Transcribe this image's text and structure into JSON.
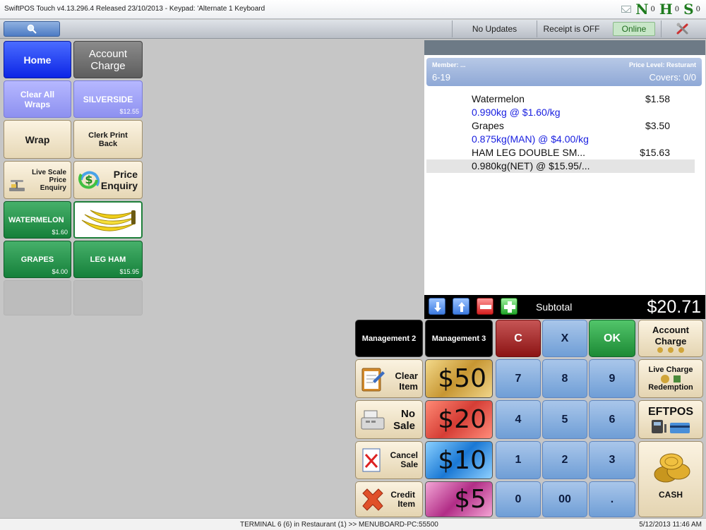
{
  "titlebar": {
    "title": "SwiftPOS Touch v4.13.296.4 Released 23/10/2013 -  Keypad: 'Alternate 1 Keyboard",
    "n_label": "N",
    "n_count": "0",
    "h_label": "H",
    "h_count": "0",
    "s_label": "S",
    "s_count": "0"
  },
  "toolbar": {
    "updates": "No Updates",
    "receipt": "Receipt is OFF",
    "online": "Online"
  },
  "left": {
    "home": "Home",
    "account_charge_1": "Account",
    "account_charge_2": "Charge",
    "clear_wraps_1": "Clear All",
    "clear_wraps_2": "Wraps",
    "silverside": "SILVERSIDE",
    "silverside_price": "$12.55",
    "wrap": "Wrap",
    "clerk_print_1": "Clerk Print",
    "clerk_print_2": "Back",
    "live_scale_1": "Live Scale",
    "live_scale_2": "Price",
    "live_scale_3": "Enquiry",
    "price_enquiry_1": "Price",
    "price_enquiry_2": "Enquiry",
    "watermelon": "WATERMELON",
    "watermelon_price": "$1.60",
    "grapes": "GRAPES",
    "grapes_price": "$4.00",
    "legham": "LEG HAM",
    "legham_price": "$15.95"
  },
  "order": {
    "member_label": "Member: ...",
    "member_number": "6-19",
    "price_level": "Price Level: Resturant",
    "covers": "Covers: 0/0",
    "items": [
      {
        "name": "Watermelon",
        "price": "$1.58",
        "detail": "0.990kg @ $1.60/kg"
      },
      {
        "name": "Grapes",
        "price": "$3.50",
        "detail": "0.875kg(MAN) @ $4.00/kg"
      },
      {
        "name": "HAM LEG DOUBLE SM...",
        "price": "$15.63",
        "detail": "0.980kg(NET) @ $15.95/..."
      }
    ],
    "subtotal_label": "Subtotal",
    "subtotal_value": "$20.71"
  },
  "keypad": {
    "management2": "Management 2",
    "management3": "Management 3",
    "c": "C",
    "x": "X",
    "ok": "OK",
    "account_charge_1": "Account",
    "account_charge_2": "Charge",
    "clear_item_1": "Clear",
    "clear_item_2": "Item",
    "no_sale_1": "No",
    "no_sale_2": "Sale",
    "cancel_sale_1": "Cancel",
    "cancel_sale_2": "Sale",
    "credit_item_1": "Credit",
    "credit_item_2": "Item",
    "m50": "$50",
    "m20": "$20",
    "m10": "$10",
    "m5": "$5",
    "k7": "7",
    "k8": "8",
    "k9": "9",
    "k4": "4",
    "k5": "5",
    "k6": "6",
    "k1": "1",
    "k2": "2",
    "k3": "3",
    "k0": "0",
    "k00": "00",
    "kdot": ".",
    "live_charge_1": "Live Charge",
    "live_charge_2": "Redemption",
    "eftpos": "EFTPOS",
    "cash": "CASH"
  },
  "status": {
    "terminal": "TERMINAL 6 (6) in Restaurant (1) >> MENUBOARD-PC:55500",
    "datetime": "5/12/2013 11:46 AM"
  }
}
